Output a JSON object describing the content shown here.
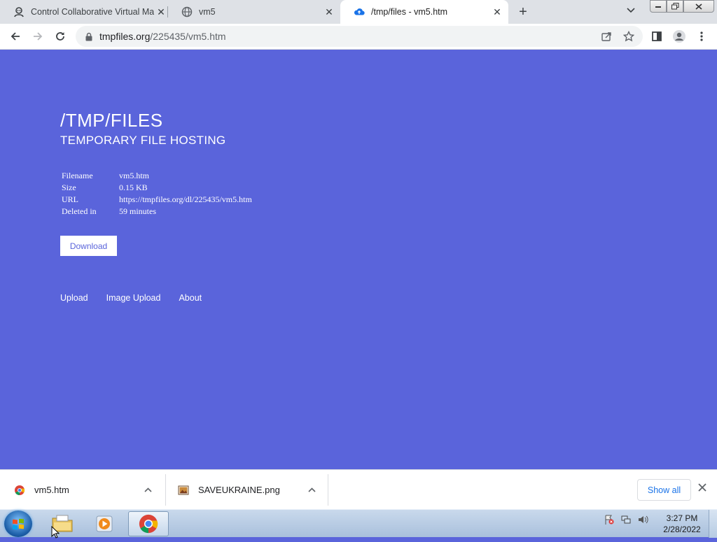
{
  "browser": {
    "tabs": [
      {
        "title": "Control Collaborative Virtual Ma",
        "icon": "vm-icon",
        "active": false
      },
      {
        "title": "vm5",
        "icon": "globe-icon",
        "active": false
      },
      {
        "title": "/tmp/files - vm5.htm",
        "icon": "cloud-upload-icon",
        "active": true
      }
    ],
    "close_glyph": "✕",
    "new_tab_glyph": "+",
    "url_host": "tmpfiles.org",
    "url_path": "/225435/vm5.htm"
  },
  "page": {
    "title": "/TMP/FILES",
    "subtitle": "TEMPORARY FILE HOSTING",
    "info": [
      {
        "key": "Filename",
        "value": "vm5.htm"
      },
      {
        "key": "Size",
        "value": "0.15 KB"
      },
      {
        "key": "URL",
        "value": "https://tmpfiles.org/dl/225435/vm5.htm"
      },
      {
        "key": "Deleted in",
        "value": "59 minutes"
      }
    ],
    "download_label": "Download",
    "footer_links": [
      "Upload",
      "Image Upload",
      "About"
    ],
    "background_color": "#5a64db"
  },
  "downloads": {
    "items": [
      {
        "name": "vm5.htm",
        "icon": "chrome-file-icon"
      },
      {
        "name": "SAVEUKRAINE.png",
        "icon": "image-file-icon"
      }
    ],
    "show_all_label": "Show all"
  },
  "taskbar": {
    "time": "3:27 PM",
    "date": "2/28/2022",
    "apps": [
      "file-explorer",
      "media-player",
      "chrome"
    ]
  }
}
